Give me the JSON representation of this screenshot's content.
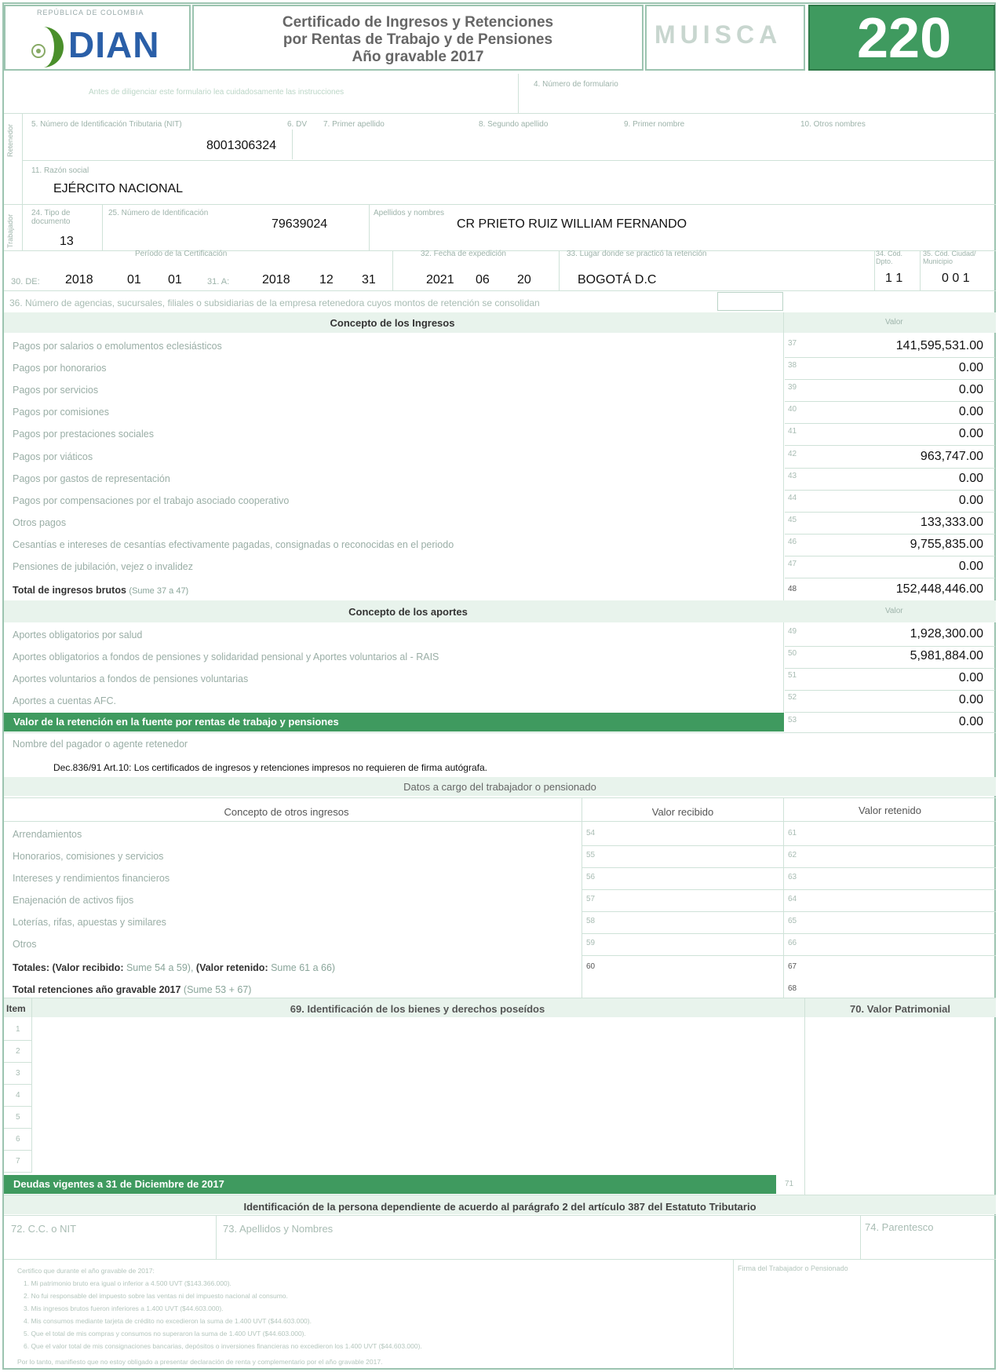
{
  "header": {
    "logo_text": "DIAN",
    "logo_top": "REPÚBLICA DE COLOMBIA",
    "title_line1": "Certificado de Ingresos y Retenciones",
    "title_line2": "por Rentas de Trabajo y de Pensiones",
    "title_line3": "Año gravable 2017",
    "muisca": "MUISCA",
    "form_number": "220"
  },
  "top": {
    "reserved": "Antes de diligenciar este formulario lea cuidadosamente las instrucciones",
    "form_no_label": "4. Número de formulario"
  },
  "retenedor": {
    "side": "Retenedor",
    "nit_label": "5. Número de Identificación Tributaria (NIT)",
    "nit": "8001306324",
    "dv_label": "6. DV",
    "ap1_label": "7. Primer apellido",
    "ap2_label": "8. Segundo apellido",
    "n1_label": "9. Primer nombre",
    "n2_label": "10. Otros nombres",
    "razon_label": "11. Razón social",
    "razon": "EJÉRCITO NACIONAL"
  },
  "trabajador": {
    "side": "Trabajador",
    "tipo_label": "24. Tipo de documento",
    "tipo": "13",
    "id_label": "25. Número de Identificación",
    "id": "79639024",
    "names_label": "Apellidos y nombres",
    "names": "CR  PRIETO RUIZ WILLIAM FERNANDO"
  },
  "periodo": {
    "label": "Período de la Certificación",
    "de_label": "30. DE:",
    "de_y": "2018",
    "de_m": "01",
    "de_d": "01",
    "a_label": "31. A:",
    "a_y": "2018",
    "a_m": "12",
    "a_d": "31",
    "exp_label": "32. Fecha de expedición",
    "exp_y": "2021",
    "exp_m": "06",
    "exp_d": "20",
    "lugar_label": "33. Lugar donde se practicó la retención",
    "lugar": "BOGOTÁ D.C",
    "dpto_label": "34. Cód. Dpto.",
    "dpto": "1 1",
    "mun_label": "35. Cód. Ciudad/ Municipio",
    "mun": "0 0 1",
    "agencias": "36. Número de agencias, sucursales, filiales o subsidiarias de la empresa retenedora cuyos montos de retención se consolidan"
  },
  "ingresos": {
    "header": "Concepto de los Ingresos",
    "valor_header": "Valor",
    "rows": [
      {
        "label": "Pagos por salarios o emolumentos eclesiásticos",
        "num": "37",
        "value": "141,595,531.00"
      },
      {
        "label": "Pagos por honorarios",
        "num": "38",
        "value": "0.00"
      },
      {
        "label": "Pagos por servicios",
        "num": "39",
        "value": "0.00"
      },
      {
        "label": "Pagos por comisiones",
        "num": "40",
        "value": "0.00"
      },
      {
        "label": "Pagos por prestaciones sociales",
        "num": "41",
        "value": "0.00"
      },
      {
        "label": "Pagos por viáticos",
        "num": "42",
        "value": "963,747.00"
      },
      {
        "label": "Pagos por gastos de representación",
        "num": "43",
        "value": "0.00"
      },
      {
        "label": "Pagos por compensaciones por el trabajo asociado cooperativo",
        "num": "44",
        "value": "0.00"
      },
      {
        "label": "Otros pagos",
        "num": "45",
        "value": "133,333.00"
      },
      {
        "label": "Cesantías e intereses de cesantías efectivamente pagadas, consignadas o reconocidas en el periodo",
        "num": "46",
        "value": "9,755,835.00"
      },
      {
        "label": "Pensiones de jubilación, vejez o invalidez",
        "num": "47",
        "value": "0.00"
      }
    ],
    "total_label": "Total de ingresos brutos",
    "total_hint": "(Sume 37 a 47)",
    "total_num": "48",
    "total_value": "152,448,446.00"
  },
  "aportes": {
    "header": "Concepto de los aportes",
    "valor_header": "Valor",
    "rows": [
      {
        "label": "Aportes obligatorios por salud",
        "num": "49",
        "value": "1,928,300.00"
      },
      {
        "label": "Aportes obligatorios a fondos de pensiones y solidaridad pensional y Aportes voluntarios al - RAIS",
        "num": "50",
        "value": "5,981,884.00"
      },
      {
        "label": "Aportes voluntarios a fondos de pensiones voluntarias",
        "num": "51",
        "value": "0.00"
      },
      {
        "label": "Aportes a cuentas AFC.",
        "num": "52",
        "value": "0.00"
      }
    ],
    "retencion_label": "Valor de la retención en la fuente por rentas de trabajo y pensiones",
    "retencion_num": "53",
    "retencion_value": "0.00"
  },
  "pagador": {
    "label": "Nombre del pagador o agente retenedor",
    "note": "Dec.836/91 Art.10: Los certificados de ingresos y retenciones impresos no requieren de firma autógrafa."
  },
  "otros": {
    "section": "Datos a cargo del trabajador o pensionado",
    "col1": "Concepto de otros ingresos",
    "col2": "Valor recibido",
    "col3": "Valor retenido",
    "rows": [
      {
        "label": "Arrendamientos",
        "n1": "54",
        "n2": "61"
      },
      {
        "label": "Honorarios, comisiones y servicios",
        "n1": "55",
        "n2": "62"
      },
      {
        "label": "Intereses y rendimientos financieros",
        "n1": "56",
        "n2": "63"
      },
      {
        "label": "Enajenación de activos fijos",
        "n1": "57",
        "n2": "64"
      },
      {
        "label": "Loterías, rifas, apuestas y similares",
        "n1": "58",
        "n2": "65"
      },
      {
        "label": "Otros",
        "n1": "59",
        "n2": "66"
      }
    ],
    "totales_label": "Totales:",
    "totales_rec": "(Valor recibido:",
    "totales_rec_hint": "Sume 54 a 59),",
    "totales_ret": "(Valor retenido:",
    "totales_ret_hint": "Sume 61 a 66)",
    "totales_n1": "60",
    "totales_n2": "67",
    "total_ret_label": "Total retenciones año gravable 2017",
    "total_ret_hint": "(Sume 53 + 67)",
    "total_ret_num": "68"
  },
  "bienes": {
    "item_header": "Item",
    "ident_header": "69. Identificación de los bienes y derechos poseídos",
    "valor_header": "70. Valor Patrimonial",
    "items": [
      "1",
      "2",
      "3",
      "4",
      "5",
      "6",
      "7"
    ],
    "deudas_label": "Deudas vigentes a 31 de Diciembre de 2017",
    "deudas_num": "71"
  },
  "dependiente": {
    "header": "Identificación de la persona dependiente de acuerdo al parágrafo 2 del artículo 387 del Estatuto Tributario",
    "cc_label": "72. C.C. o NIT",
    "names_label": "73. Apellidos y Nombres",
    "parentesco_label": "74. Parentesco"
  },
  "footer": {
    "certifico": "Certifico que durante el año gravable de 2017:",
    "lines": [
      "1.  Mi patrimonio bruto era igual o inferior a 4.500 UVT ($143.366.000).",
      "2.  No fui responsable del impuesto sobre las ventas ni del impuesto nacional al consumo.",
      "3.  Mis ingresos brutos fueron inferiores a 1.400 UVT ($44.603.000).",
      "4.  Mis consumos mediante tarjeta de crédito no excedieron la suma de 1.400 UVT ($44.603.000).",
      "5.  Que el total de mis compras y consumos no superaron la suma de 1.400 UVT ($44.603.000).",
      "6.  Que el valor total de mis consignaciones bancarias, depósitos o inversiones financieras no excedieron los 1.400 UVT ($44.603.000)."
    ],
    "closing": "Por lo tanto, manifiesto que no estoy obligado a presentar declaración de renta y complementario por el año gravable 2017.",
    "firma_label": "Firma del Trabajador o Pensionado"
  }
}
